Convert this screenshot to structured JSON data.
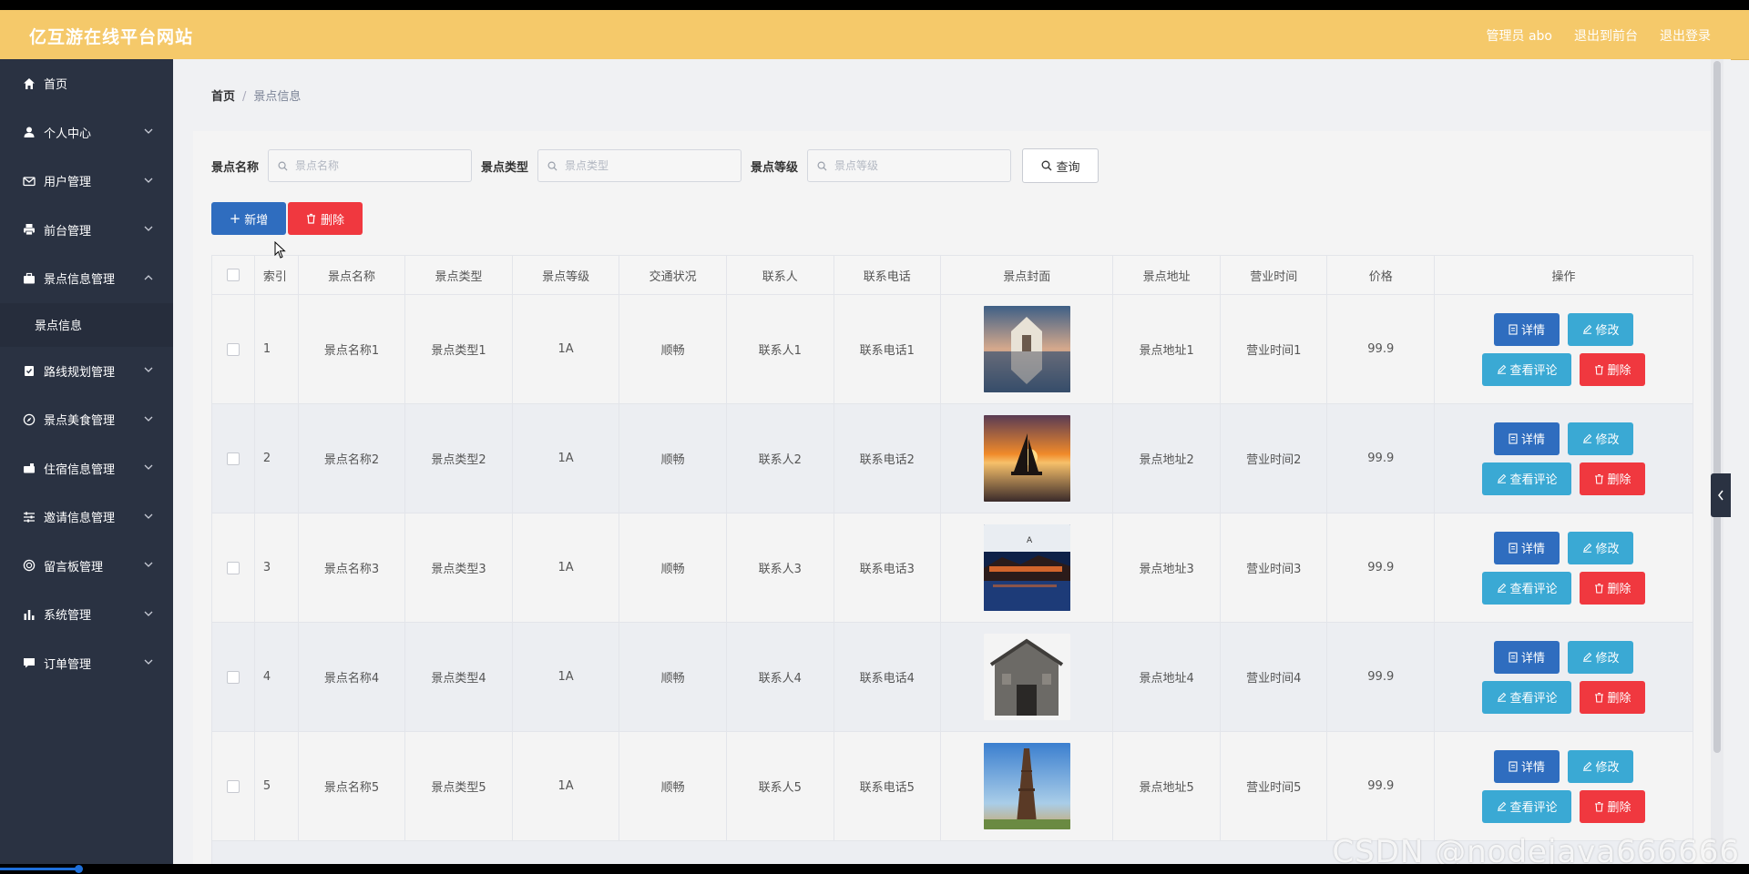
{
  "header": {
    "brand": "亿互游在线平台网站",
    "admin": "管理员 abo",
    "to_front": "退出到前台",
    "logout": "退出登录"
  },
  "sidebar": {
    "items": [
      {
        "label": "首页",
        "icon": "home-icon"
      },
      {
        "label": "个人中心",
        "icon": "user-icon"
      },
      {
        "label": "用户管理",
        "icon": "mail-icon"
      },
      {
        "label": "前台管理",
        "icon": "printer-icon"
      },
      {
        "label": "景点信息管理",
        "icon": "briefcase-icon",
        "expanded": true
      },
      {
        "label": "景点信息",
        "sub": true
      },
      {
        "label": "路线规划管理",
        "icon": "clipboard-icon"
      },
      {
        "label": "景点美食管理",
        "icon": "compass-icon"
      },
      {
        "label": "住宿信息管理",
        "icon": "suitcase-icon"
      },
      {
        "label": "邀请信息管理",
        "icon": "sliders-icon"
      },
      {
        "label": "留言板管理",
        "icon": "circle-icon"
      },
      {
        "label": "系统管理",
        "icon": "bar-chart-icon"
      },
      {
        "label": "订单管理",
        "icon": "chat-icon"
      }
    ]
  },
  "breadcrumb": {
    "home": "首页",
    "current": "景点信息"
  },
  "search": {
    "name_label": "景点名称",
    "name_placeholder": "景点名称",
    "type_label": "景点类型",
    "type_placeholder": "景点类型",
    "level_label": "景点等级",
    "level_placeholder": "景点等级",
    "query": "查询"
  },
  "actions": {
    "add": "新增",
    "delete": "删除"
  },
  "table": {
    "headers": [
      "",
      "索引",
      "景点名称",
      "景点类型",
      "景点等级",
      "交通状况",
      "联系人",
      "联系电话",
      "景点封面",
      "景点地址",
      "营业时间",
      "价格",
      "操作"
    ],
    "rows": [
      {
        "index": "1",
        "name": "景点名称1",
        "type": "景点类型1",
        "level": "1A",
        "traffic": "顺畅",
        "contact": "联系人1",
        "phone": "联系电话1",
        "address": "景点地址1",
        "hours": "营业时间1",
        "price": "99.9"
      },
      {
        "index": "2",
        "name": "景点名称2",
        "type": "景点类型2",
        "level": "1A",
        "traffic": "顺畅",
        "contact": "联系人2",
        "phone": "联系电话2",
        "address": "景点地址2",
        "hours": "营业时间2",
        "price": "99.9"
      },
      {
        "index": "3",
        "name": "景点名称3",
        "type": "景点类型3",
        "level": "1A",
        "traffic": "顺畅",
        "contact": "联系人3",
        "phone": "联系电话3",
        "address": "景点地址3",
        "hours": "营业时间3",
        "price": "99.9"
      },
      {
        "index": "4",
        "name": "景点名称4",
        "type": "景点类型4",
        "level": "1A",
        "traffic": "顺畅",
        "contact": "联系人4",
        "phone": "联系电话4",
        "address": "景点地址4",
        "hours": "营业时间4",
        "price": "99.9"
      },
      {
        "index": "5",
        "name": "景点名称5",
        "type": "景点类型5",
        "level": "1A",
        "traffic": "顺畅",
        "contact": "联系人5",
        "phone": "联系电话5",
        "address": "景点地址5",
        "hours": "营业时间5",
        "price": "99.9"
      }
    ],
    "ops": {
      "detail": "详情",
      "edit": "修改",
      "comment": "查看评论",
      "delete": "删除"
    }
  },
  "watermark": "CSDN @nodejava666666",
  "video_progress": 0.045,
  "colors": {
    "header": "#f5c96a",
    "sidebar": "#2a3242",
    "primary": "#2f6dbf",
    "danger": "#f0383f",
    "info": "#3aa9d4"
  }
}
